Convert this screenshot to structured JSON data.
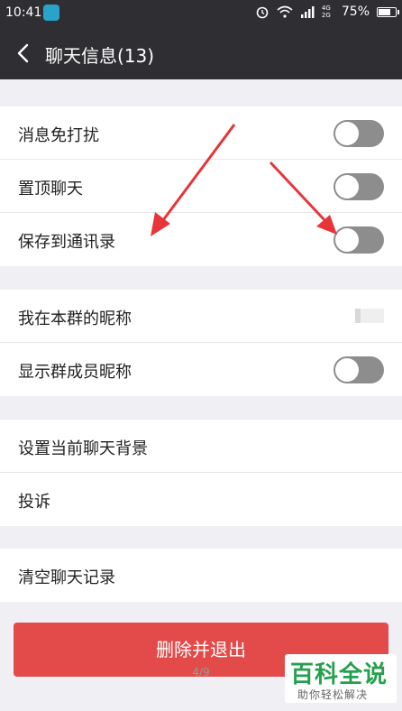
{
  "status_bar": {
    "time": "10:41",
    "network_label": "4G 2G",
    "battery_percent": "75%",
    "battery_level": 0.75
  },
  "header": {
    "title": "聊天信息(13)"
  },
  "group1": {
    "rows": [
      {
        "label": "消息免打扰",
        "toggle_on": false
      },
      {
        "label": "置顶聊天",
        "toggle_on": false
      },
      {
        "label": "保存到通讯录",
        "toggle_on": false
      }
    ]
  },
  "group2": {
    "rows": [
      {
        "label": "我在本群的昵称"
      },
      {
        "label": "显示群成员昵称",
        "toggle_on": false
      }
    ]
  },
  "group3": {
    "rows": [
      {
        "label": "设置当前聊天背景"
      },
      {
        "label": "投诉"
      }
    ]
  },
  "group4": {
    "rows": [
      {
        "label": "清空聊天记录"
      }
    ]
  },
  "delete_button": {
    "label": "删除并退出"
  },
  "page_indicator": "4/9",
  "watermark": {
    "title": "百科全说",
    "subtitle": "助你轻松解决"
  },
  "colors": {
    "header_bg": "#2e2e33",
    "toggle_off": "#8d8d8d",
    "delete_bg": "#e34a4a",
    "arrow": "#e8353a",
    "watermark_green": "#27a04e"
  }
}
